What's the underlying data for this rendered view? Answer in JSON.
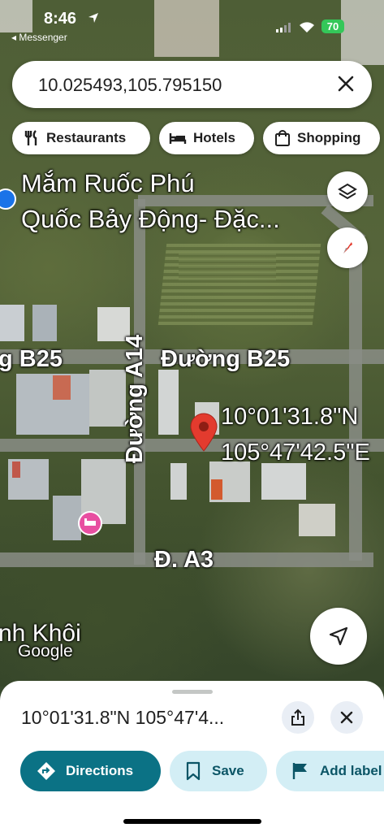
{
  "status_bar": {
    "time": "8:46",
    "back_app": "◂ Messenger",
    "battery": "70"
  },
  "search": {
    "query": "10.025493,105.795150"
  },
  "chips": [
    {
      "label": "Restaurants",
      "icon": "fork-knife-icon"
    },
    {
      "label": "Hotels",
      "icon": "bed-icon"
    },
    {
      "label": "Shopping",
      "icon": "shopping-bag-icon"
    }
  ],
  "map": {
    "poi_line1": "Mắm Ruốc Phú",
    "poi_line2": "Quốc Bảy Động-  Đặc...",
    "road_b25_left": "g B25",
    "road_b25": "Đường B25",
    "road_a14": "Đường A14",
    "road_a3": "Đ. A3",
    "pin_lat": "10°01'31.8\"N",
    "pin_lng": "105°47'42.5\"E",
    "place_partial": "nh Khôi",
    "google": "Google",
    "pin_color": "#e33b2e",
    "hotel_pin_color": "#e84fa1"
  },
  "sheet": {
    "title": "10°01'31.8\"N 105°47'4...",
    "buttons": {
      "directions": "Directions",
      "save": "Save",
      "add_label": "Add label"
    }
  },
  "colors": {
    "accent": "#0b7285",
    "light_button": "#d3eef5",
    "text": "#1f1f1f"
  }
}
